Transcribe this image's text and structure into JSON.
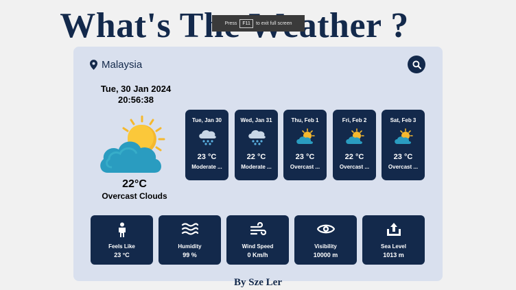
{
  "title": "What's The Weather ?",
  "fullscreen_hint": {
    "pre": "Press",
    "key": "F11",
    "post": "to exit full screen"
  },
  "location": {
    "name": "Malaysia",
    "icon": "map-pin-icon"
  },
  "search": {
    "icon": "search-icon"
  },
  "current": {
    "date": "Tue, 30 Jan 2024",
    "time": "20:56:38",
    "temperature": "22°C",
    "description": "Overcast Clouds",
    "icon": "sun-behind-cloud-icon"
  },
  "forecast": [
    {
      "date": "Tue, Jan 30",
      "temp": "23 °C",
      "desc": "Moderate ...",
      "icon": "rain-cloud-icon"
    },
    {
      "date": "Wed, Jan 31",
      "temp": "22 °C",
      "desc": "Moderate ...",
      "icon": "rain-cloud-icon"
    },
    {
      "date": "Thu, Feb 1",
      "temp": "23 °C",
      "desc": "Overcast ...",
      "icon": "sun-behind-cloud-icon"
    },
    {
      "date": "Fri, Feb 2",
      "temp": "22 °C",
      "desc": "Overcast ...",
      "icon": "sun-behind-cloud-icon"
    },
    {
      "date": "Sat, Feb 3",
      "temp": "23 °C",
      "desc": "Overcast ...",
      "icon": "sun-behind-cloud-icon"
    }
  ],
  "stats": [
    {
      "label": "Feels Like",
      "value": "23 °C",
      "icon": "person-icon"
    },
    {
      "label": "Humidity",
      "value": "99 %",
      "icon": "water-waves-icon"
    },
    {
      "label": "Wind Speed",
      "value": "0 Km/h",
      "icon": "wind-icon"
    },
    {
      "label": "Visibility",
      "value": "10000 m",
      "icon": "eye-icon"
    },
    {
      "label": "Sea Level",
      "value": "1013 m",
      "icon": "sea-level-icon"
    }
  ],
  "byline": "By Sze Ler",
  "colors": {
    "navy": "#13294b",
    "card": "#d9e0ee",
    "sun": "#f5b82e",
    "cloud": "#2a9cc0"
  }
}
